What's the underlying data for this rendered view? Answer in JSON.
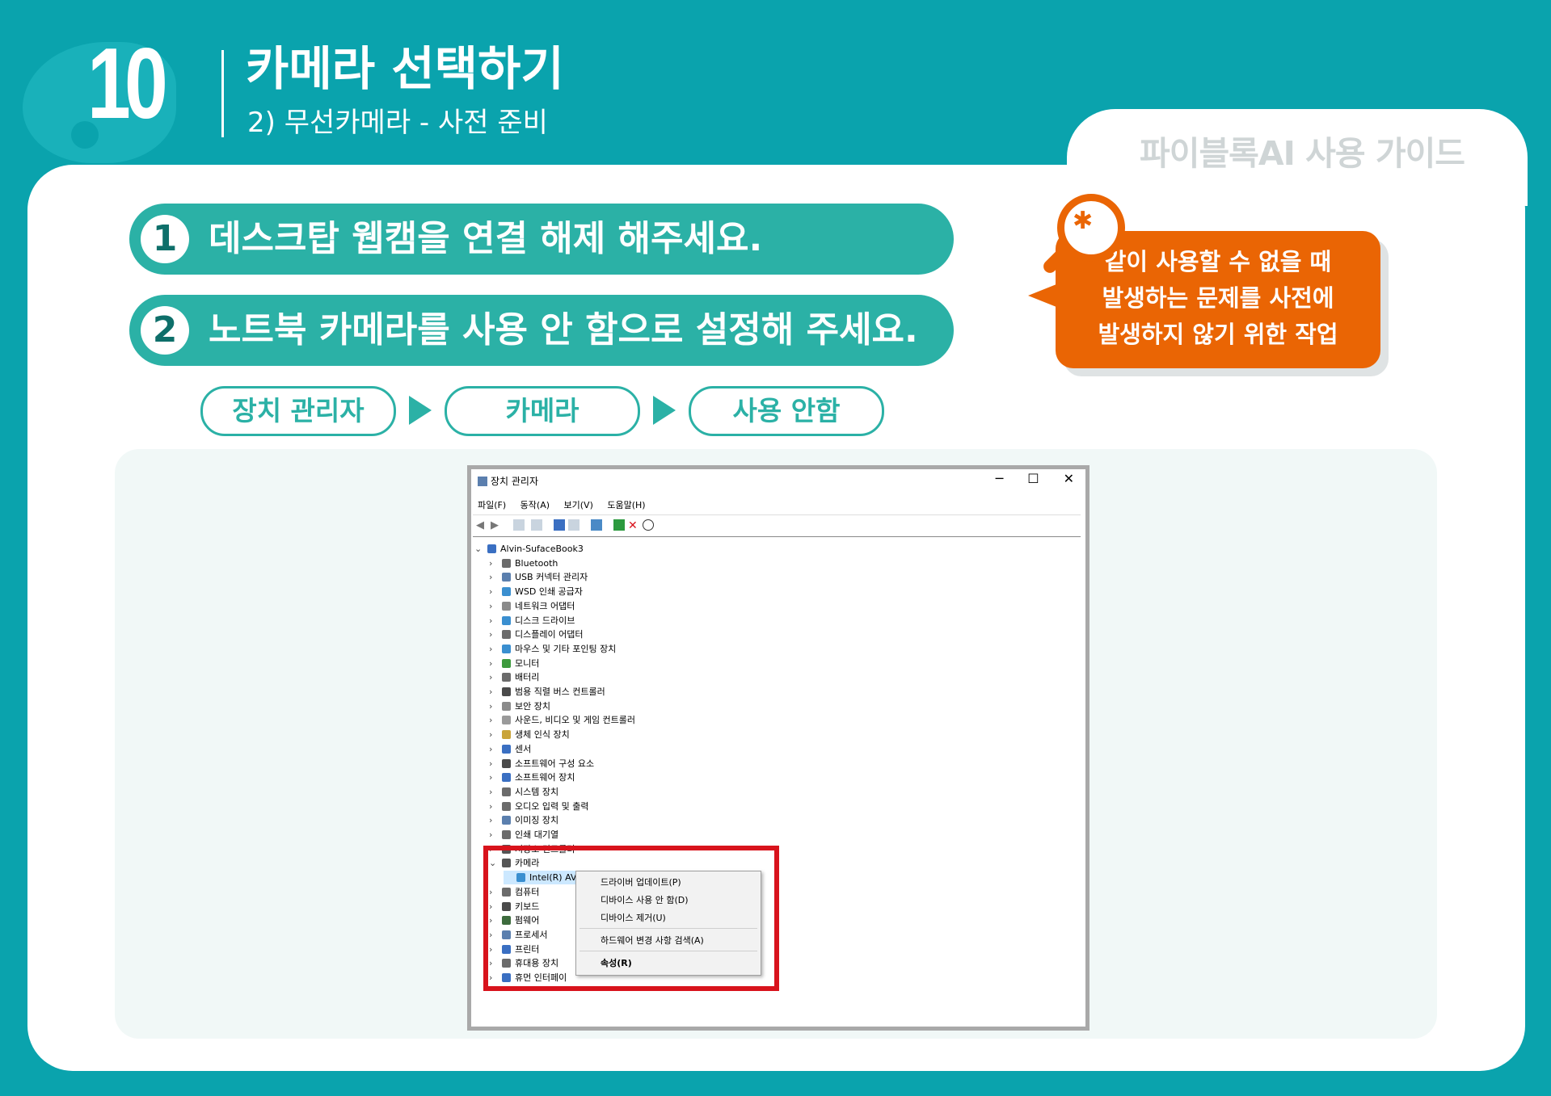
{
  "header": {
    "step_number": "10",
    "title": "카메라 선택하기",
    "subtitle": "2) 무선카메라 - 사전 준비",
    "guide_label": "파이블록AI 사용 가이드"
  },
  "steps": [
    {
      "num": "1",
      "text": "데스크탑 웹캠을 연결 해제 해주세요."
    },
    {
      "num": "2",
      "text": "노트북 카메라를 사용 안 함으로 설정해 주세요."
    }
  ],
  "flow": [
    "장치 관리자",
    "카메라",
    "사용 안함"
  ],
  "note": {
    "lines": [
      "같이 사용할 수 없을 때",
      "발생하는 문제를 사전에",
      "발생하지 않기 위한 작업"
    ],
    "icon": "bug-search-icon",
    "color": "#ea6504"
  },
  "device_manager": {
    "window_title": "장치 관리자",
    "menu": [
      "파일(F)",
      "동작(A)",
      "보기(V)",
      "도움말(H)"
    ],
    "root": "Alvin-SufaceBook3",
    "items": [
      "Bluetooth",
      "USB 커넥터 관리자",
      "WSD 인쇄 공급자",
      "네트워크 어댑터",
      "디스크 드라이브",
      "디스플레이 어댑터",
      "마우스 및 기타 포인팅 장치",
      "모니터",
      "배터리",
      "범용 직렬 버스 컨트롤러",
      "보안 장치",
      "사운드, 비디오 및 게임 컨트롤러",
      "생체 인식 장치",
      "센서",
      "소프트웨어 구성 요소",
      "소프트웨어 장치",
      "시스템 장치",
      "오디오 입력 및 출력",
      "이미징 장치",
      "인쇄 대기열",
      "저장소 컨트롤러",
      "카메라",
      "Intel(R) AVStream Camera",
      "컴퓨터",
      "키보드",
      "펌웨어",
      "프로세서",
      "프린터",
      "휴대용 장치",
      "휴먼 인터페이"
    ],
    "context_menu": [
      "드라이버 업데이트(P)",
      "디바이스 사용 안 함(D)",
      "디바이스 제거(U)",
      "하드웨어 변경 사항 검색(A)",
      "속성(R)"
    ]
  },
  "colors": {
    "background": "#0aa3ad",
    "accent": "#2bb1a6",
    "highlight": "#d8131c"
  }
}
